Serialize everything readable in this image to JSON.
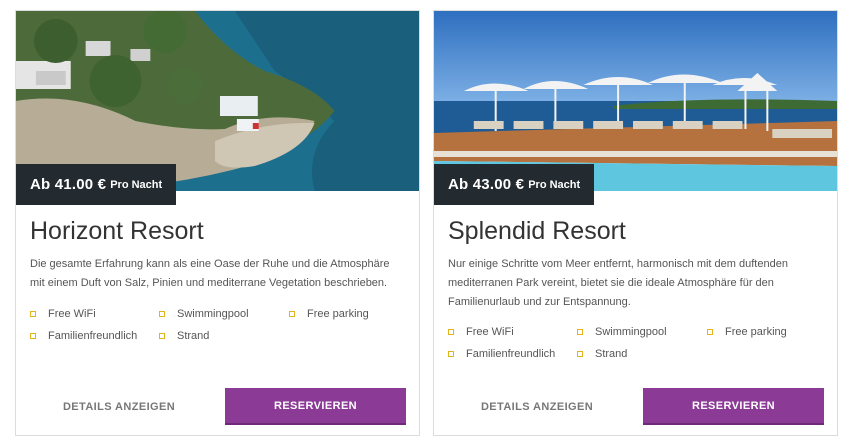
{
  "colors": {
    "accent": "#8b3a96",
    "price_badge": "#232a30",
    "bullet": "#e3b51b"
  },
  "cards": [
    {
      "price": "Ab 41.00 €",
      "price_unit": "Pro Nacht",
      "image_alt": "Aerial view of coastline with resort buildings",
      "title": "Horizont Resort",
      "description": "Die gesamte Erfahrung kann als eine Oase der Ruhe und die Atmosphäre mit einem Duft von Salz, Pinien und mediterrane Vegetation beschrieben.",
      "features": [
        "Free WiFi",
        "Swimmingpool",
        "Free parking",
        "Familienfreundlich",
        "Strand"
      ],
      "details_label": "DETAILS ANZEIGEN",
      "reserve_label": "RESERVIEREN"
    },
    {
      "price": "Ab 43.00 €",
      "price_unit": "Pro Nacht",
      "image_alt": "Pool terrace with sun loungers and umbrellas by the sea",
      "title": "Splendid Resort",
      "description": "Nur einige Schritte vom Meer entfernt, harmonisch mit dem duftenden mediterranen Park vereint, bietet sie die ideale Atmosphäre für den Familienurlaub und zur Entspannung.",
      "features": [
        "Free WiFi",
        "Swimmingpool",
        "Free parking",
        "Familienfreundlich",
        "Strand"
      ],
      "details_label": "DETAILS ANZEIGEN",
      "reserve_label": "RESERVIEREN"
    }
  ]
}
